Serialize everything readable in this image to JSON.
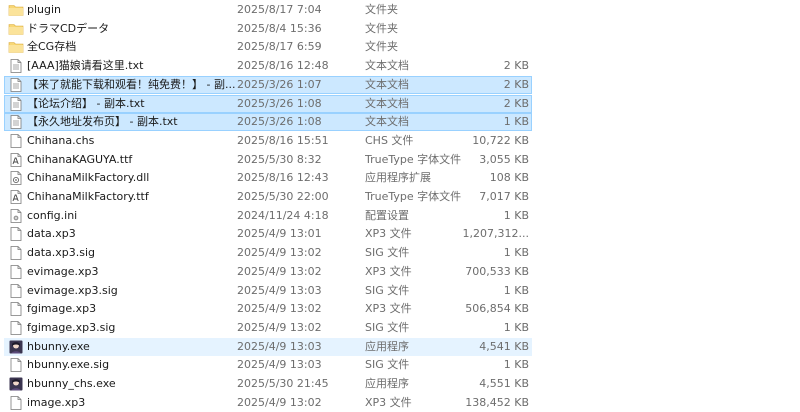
{
  "colors": {
    "folder": "#f8d775",
    "selection": "#cce8ff",
    "selection_border": "#99d1ff",
    "hover": "#e5f3ff",
    "muted_text": "#6d6d6d"
  },
  "files": [
    {
      "name": "plugin",
      "date": "2025/8/17 7:04",
      "type": "文件夹",
      "size": "",
      "icon": "folder-icon",
      "state": ""
    },
    {
      "name": "ドラマCDデータ",
      "date": "2025/8/4 15:36",
      "type": "文件夹",
      "size": "",
      "icon": "folder-icon",
      "state": ""
    },
    {
      "name": "全CG存档",
      "date": "2025/8/17 6:59",
      "type": "文件夹",
      "size": "",
      "icon": "folder-icon",
      "state": ""
    },
    {
      "name": "[AAA]猫娘请看这里.txt",
      "date": "2025/8/16 12:48",
      "type": "文本文档",
      "size": "2 KB",
      "icon": "text-file-icon",
      "state": ""
    },
    {
      "name": "【来了就能下载和观看！纯免费！】 - 副...",
      "date": "2025/3/26 1:07",
      "type": "文本文档",
      "size": "2 KB",
      "icon": "text-file-icon",
      "state": "selected"
    },
    {
      "name": "【论坛介绍】 - 副本.txt",
      "date": "2025/3/26 1:08",
      "type": "文本文档",
      "size": "2 KB",
      "icon": "text-file-icon",
      "state": "selected"
    },
    {
      "name": "【永久地址发布页】 - 副本.txt",
      "date": "2025/3/26 1:08",
      "type": "文本文档",
      "size": "1 KB",
      "icon": "text-file-icon",
      "state": "selected"
    },
    {
      "name": "Chihana.chs",
      "date": "2025/8/16 15:51",
      "type": "CHS 文件",
      "size": "10,722 KB",
      "icon": "blank-file-icon",
      "state": ""
    },
    {
      "name": "ChihanaKAGUYA.ttf",
      "date": "2025/5/30 8:32",
      "type": "TrueType 字体文件",
      "size": "3,055 KB",
      "icon": "font-file-icon",
      "state": ""
    },
    {
      "name": "ChihanaMilkFactory.dll",
      "date": "2025/8/16 12:43",
      "type": "应用程序扩展",
      "size": "108 KB",
      "icon": "dll-file-icon",
      "state": ""
    },
    {
      "name": "ChihanaMilkFactory.ttf",
      "date": "2025/5/30 22:00",
      "type": "TrueType 字体文件",
      "size": "7,017 KB",
      "icon": "font-file-icon",
      "state": ""
    },
    {
      "name": "config.ini",
      "date": "2024/11/24 4:18",
      "type": "配置设置",
      "size": "1 KB",
      "icon": "config-file-icon",
      "state": ""
    },
    {
      "name": "data.xp3",
      "date": "2025/4/9 13:01",
      "type": "XP3 文件",
      "size": "1,207,312...",
      "icon": "blank-file-icon",
      "state": ""
    },
    {
      "name": "data.xp3.sig",
      "date": "2025/4/9 13:02",
      "type": "SIG 文件",
      "size": "1 KB",
      "icon": "blank-file-icon",
      "state": ""
    },
    {
      "name": "evimage.xp3",
      "date": "2025/4/9 13:02",
      "type": "XP3 文件",
      "size": "700,533 KB",
      "icon": "blank-file-icon",
      "state": ""
    },
    {
      "name": "evimage.xp3.sig",
      "date": "2025/4/9 13:03",
      "type": "SIG 文件",
      "size": "1 KB",
      "icon": "blank-file-icon",
      "state": ""
    },
    {
      "name": "fgimage.xp3",
      "date": "2025/4/9 13:02",
      "type": "XP3 文件",
      "size": "506,854 KB",
      "icon": "blank-file-icon",
      "state": ""
    },
    {
      "name": "fgimage.xp3.sig",
      "date": "2025/4/9 13:02",
      "type": "SIG 文件",
      "size": "1 KB",
      "icon": "blank-file-icon",
      "state": ""
    },
    {
      "name": "hbunny.exe",
      "date": "2025/4/9 13:03",
      "type": "应用程序",
      "size": "4,541 KB",
      "icon": "app-exe-icon",
      "state": "hover"
    },
    {
      "name": "hbunny.exe.sig",
      "date": "2025/4/9 13:03",
      "type": "SIG 文件",
      "size": "1 KB",
      "icon": "blank-file-icon",
      "state": ""
    },
    {
      "name": "hbunny_chs.exe",
      "date": "2025/5/30 21:45",
      "type": "应用程序",
      "size": "4,551 KB",
      "icon": "app-exe-icon",
      "state": ""
    },
    {
      "name": "image.xp3",
      "date": "2025/4/9 13:02",
      "type": "XP3 文件",
      "size": "138,452 KB",
      "icon": "blank-file-icon",
      "state": ""
    }
  ]
}
